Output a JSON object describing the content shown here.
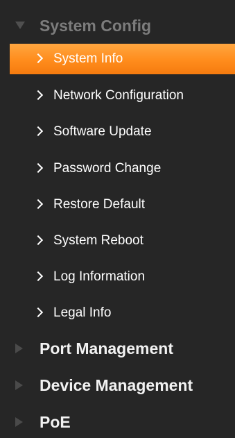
{
  "sidebar": {
    "system_config": {
      "label": "System Config",
      "expanded": true,
      "icon": "triangle-down-icon",
      "items": [
        {
          "label": "System Info",
          "active": true
        },
        {
          "label": "Network Configuration",
          "active": false
        },
        {
          "label": "Software Update",
          "active": false
        },
        {
          "label": "Password Change",
          "active": false
        },
        {
          "label": "Restore Default",
          "active": false
        },
        {
          "label": "System Reboot",
          "active": false
        },
        {
          "label": "Log Information",
          "active": false
        },
        {
          "label": "Legal Info",
          "active": false
        }
      ]
    },
    "port_management": {
      "label": "Port Management",
      "expanded": false,
      "icon": "triangle-right-icon"
    },
    "device_management": {
      "label": "Device Management",
      "expanded": false,
      "icon": "triangle-right-icon"
    },
    "poe": {
      "label": "PoE",
      "expanded": false,
      "icon": "triangle-right-icon"
    }
  },
  "colors": {
    "background": "#262626",
    "active_item": "#ff8c1c",
    "expanded_header_text": "#7c7c7c",
    "collapsed_header_text": "#f2f2f2",
    "item_text": "#ffffff"
  }
}
